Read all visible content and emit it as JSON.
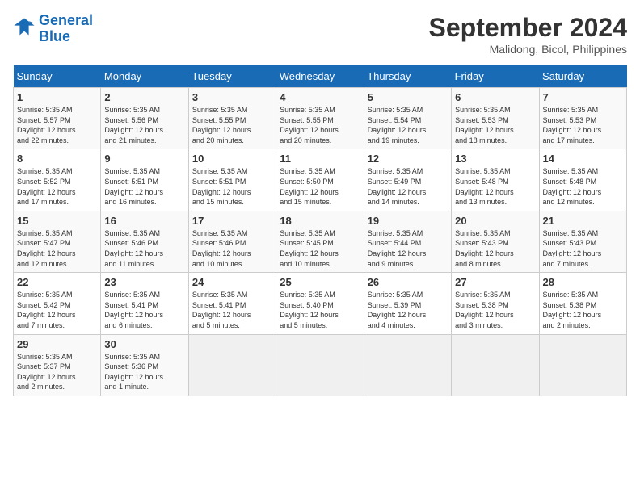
{
  "header": {
    "logo_line1": "General",
    "logo_line2": "Blue",
    "month_year": "September 2024",
    "location": "Malidong, Bicol, Philippines"
  },
  "calendar": {
    "days_of_week": [
      "Sunday",
      "Monday",
      "Tuesday",
      "Wednesday",
      "Thursday",
      "Friday",
      "Saturday"
    ],
    "weeks": [
      [
        {
          "day": "",
          "empty": true
        },
        {
          "day": "",
          "empty": true
        },
        {
          "day": "",
          "empty": true
        },
        {
          "day": "",
          "empty": true
        },
        {
          "day": "",
          "empty": true
        },
        {
          "day": "",
          "empty": true
        },
        {
          "day": "",
          "empty": true
        }
      ]
    ],
    "cells": [
      {
        "date": "",
        "info": ""
      },
      {
        "date": "",
        "info": ""
      },
      {
        "date": "",
        "info": ""
      },
      {
        "date": "",
        "info": ""
      },
      {
        "date": "",
        "info": ""
      },
      {
        "date": "",
        "info": ""
      },
      {
        "date": "",
        "info": ""
      },
      {
        "date": "1",
        "sunrise": "5:35 AM",
        "sunset": "5:57 PM",
        "daylight": "12 hours and 22 minutes."
      },
      {
        "date": "2",
        "sunrise": "5:35 AM",
        "sunset": "5:56 PM",
        "daylight": "12 hours and 21 minutes."
      },
      {
        "date": "3",
        "sunrise": "5:35 AM",
        "sunset": "5:55 PM",
        "daylight": "12 hours and 20 minutes."
      },
      {
        "date": "4",
        "sunrise": "5:35 AM",
        "sunset": "5:55 PM",
        "daylight": "12 hours and 20 minutes."
      },
      {
        "date": "5",
        "sunrise": "5:35 AM",
        "sunset": "5:54 PM",
        "daylight": "12 hours and 19 minutes."
      },
      {
        "date": "6",
        "sunrise": "5:35 AM",
        "sunset": "5:53 PM",
        "daylight": "12 hours and 18 minutes."
      },
      {
        "date": "7",
        "sunrise": "5:35 AM",
        "sunset": "5:53 PM",
        "daylight": "12 hours and 17 minutes."
      },
      {
        "date": "8",
        "sunrise": "5:35 AM",
        "sunset": "5:52 PM",
        "daylight": "12 hours and 17 minutes."
      },
      {
        "date": "9",
        "sunrise": "5:35 AM",
        "sunset": "5:51 PM",
        "daylight": "12 hours and 16 minutes."
      },
      {
        "date": "10",
        "sunrise": "5:35 AM",
        "sunset": "5:51 PM",
        "daylight": "12 hours and 15 minutes."
      },
      {
        "date": "11",
        "sunrise": "5:35 AM",
        "sunset": "5:50 PM",
        "daylight": "12 hours and 15 minutes."
      },
      {
        "date": "12",
        "sunrise": "5:35 AM",
        "sunset": "5:49 PM",
        "daylight": "12 hours and 14 minutes."
      },
      {
        "date": "13",
        "sunrise": "5:35 AM",
        "sunset": "5:48 PM",
        "daylight": "12 hours and 13 minutes."
      },
      {
        "date": "14",
        "sunrise": "5:35 AM",
        "sunset": "5:48 PM",
        "daylight": "12 hours and 12 minutes."
      },
      {
        "date": "15",
        "sunrise": "5:35 AM",
        "sunset": "5:47 PM",
        "daylight": "12 hours and 12 minutes."
      },
      {
        "date": "16",
        "sunrise": "5:35 AM",
        "sunset": "5:46 PM",
        "daylight": "12 hours and 11 minutes."
      },
      {
        "date": "17",
        "sunrise": "5:35 AM",
        "sunset": "5:46 PM",
        "daylight": "12 hours and 10 minutes."
      },
      {
        "date": "18",
        "sunrise": "5:35 AM",
        "sunset": "5:45 PM",
        "daylight": "12 hours and 10 minutes."
      },
      {
        "date": "19",
        "sunrise": "5:35 AM",
        "sunset": "5:44 PM",
        "daylight": "12 hours and 9 minutes."
      },
      {
        "date": "20",
        "sunrise": "5:35 AM",
        "sunset": "5:43 PM",
        "daylight": "12 hours and 8 minutes."
      },
      {
        "date": "21",
        "sunrise": "5:35 AM",
        "sunset": "5:43 PM",
        "daylight": "12 hours and 7 minutes."
      },
      {
        "date": "22",
        "sunrise": "5:35 AM",
        "sunset": "5:42 PM",
        "daylight": "12 hours and 7 minutes."
      },
      {
        "date": "23",
        "sunrise": "5:35 AM",
        "sunset": "5:41 PM",
        "daylight": "12 hours and 6 minutes."
      },
      {
        "date": "24",
        "sunrise": "5:35 AM",
        "sunset": "5:41 PM",
        "daylight": "12 hours and 5 minutes."
      },
      {
        "date": "25",
        "sunrise": "5:35 AM",
        "sunset": "5:40 PM",
        "daylight": "12 hours and 5 minutes."
      },
      {
        "date": "26",
        "sunrise": "5:35 AM",
        "sunset": "5:39 PM",
        "daylight": "12 hours and 4 minutes."
      },
      {
        "date": "27",
        "sunrise": "5:35 AM",
        "sunset": "5:38 PM",
        "daylight": "12 hours and 3 minutes."
      },
      {
        "date": "28",
        "sunrise": "5:35 AM",
        "sunset": "5:38 PM",
        "daylight": "12 hours and 2 minutes."
      },
      {
        "date": "29",
        "sunrise": "5:35 AM",
        "sunset": "5:37 PM",
        "daylight": "12 hours and 2 minutes."
      },
      {
        "date": "30",
        "sunrise": "5:35 AM",
        "sunset": "5:36 PM",
        "daylight": "12 hours and 1 minute."
      },
      {
        "date": "",
        "info": ""
      },
      {
        "date": "",
        "info": ""
      },
      {
        "date": "",
        "info": ""
      },
      {
        "date": "",
        "info": ""
      },
      {
        "date": "",
        "info": ""
      }
    ]
  }
}
